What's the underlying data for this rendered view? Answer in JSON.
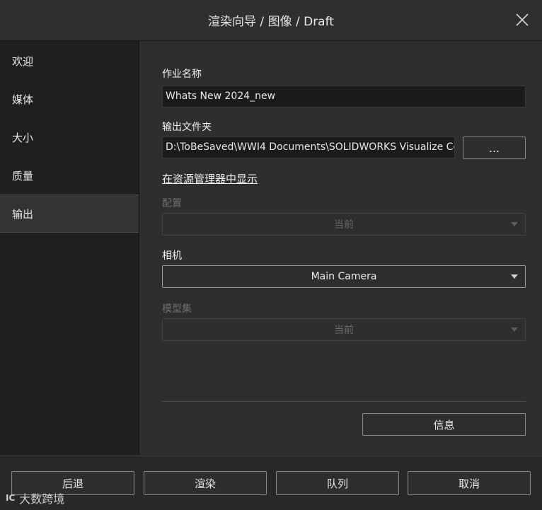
{
  "window": {
    "title": "渲染向导 / 图像 / Draft",
    "close_icon": "close-icon"
  },
  "sidebar": {
    "items": [
      {
        "label": "欢迎",
        "active": false
      },
      {
        "label": "媒体",
        "active": false
      },
      {
        "label": "大小",
        "active": false
      },
      {
        "label": "质量",
        "active": false
      },
      {
        "label": "输出",
        "active": true
      }
    ]
  },
  "output": {
    "job_name_label": "作业名称",
    "job_name_value": "Whats New 2024_new",
    "folder_label": "输出文件夹",
    "folder_value": "D:\\ToBeSaved\\WWI4 Documents\\SOLIDWORKS Visualize Co",
    "browse_label": "...",
    "show_in_explorer": "在资源管理器中显示",
    "config_label": "配置",
    "config_value": "当前",
    "camera_label": "相机",
    "camera_value": "Main Camera",
    "modelset_label": "模型集",
    "modelset_value": "当前",
    "info_button": "信息"
  },
  "footer": {
    "back": "后退",
    "render": "渲染",
    "queue": "队列",
    "cancel": "取消"
  },
  "watermark": {
    "logo": "IC",
    "text": "大数跨境"
  },
  "colors": {
    "background": "#262626",
    "sidebar": "#1f1f1f",
    "content": "#2e2e2e",
    "field": "#1b1b1b"
  }
}
